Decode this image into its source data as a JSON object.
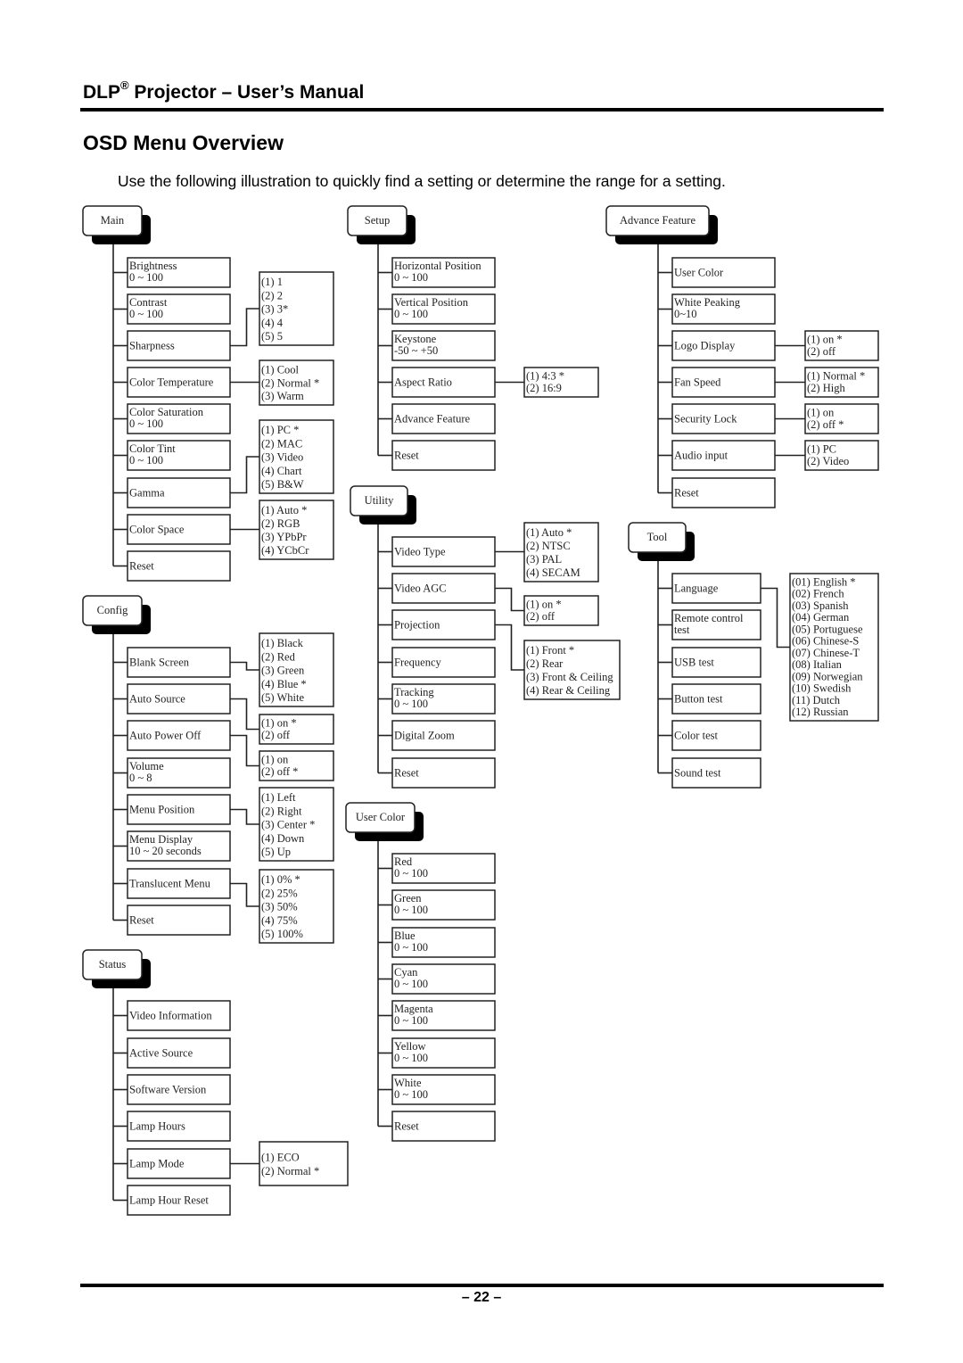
{
  "header": {
    "product": "DLP",
    "registered_mark": "®",
    "rest": " Projector – User’s Manual"
  },
  "section_title": "OSD Menu Overview",
  "intro": "Use the following illustration to quickly find a setting or determine the range for a setting.",
  "page_number": "– 22 –",
  "menus": [
    {
      "id": "main",
      "title": "Main",
      "items": [
        {
          "lines": [
            "Brightness",
            "0 ~ 100"
          ]
        },
        {
          "lines": [
            "Contrast",
            "0 ~ 100"
          ]
        },
        {
          "lines": [
            "Sharpness"
          ],
          "options": [
            "(1) 1",
            "(2) 2",
            "(3) 3*",
            "(4) 4",
            "(5) 5"
          ]
        },
        {
          "lines": [
            "Color Temperature"
          ],
          "options": [
            "(1) Cool",
            "(2) Normal *",
            "(3) Warm"
          ]
        },
        {
          "lines": [
            "Color Saturation",
            "0 ~ 100"
          ]
        },
        {
          "lines": [
            "Color Tint",
            "0 ~ 100"
          ]
        },
        {
          "lines": [
            "Gamma"
          ],
          "options": [
            "(1) PC *",
            "(2) MAC",
            "(3) Video",
            "(4) Chart",
            "(5) B&W"
          ]
        },
        {
          "lines": [
            "Color Space"
          ],
          "options": [
            "(1) Auto *",
            "(2) RGB",
            "(3) YPbPr",
            "(4) YCbCr"
          ]
        },
        {
          "lines": [
            "Reset"
          ]
        }
      ]
    },
    {
      "id": "config",
      "title": "Config",
      "items": [
        {
          "lines": [
            "Blank Screen"
          ],
          "options": [
            "(1) Black",
            "(2) Red",
            "(3) Green",
            "(4) Blue *",
            "(5) White"
          ]
        },
        {
          "lines": [
            "Auto Source"
          ],
          "options": [
            "(1) on *",
            "(2) off"
          ]
        },
        {
          "lines": [
            "Auto Power Off"
          ],
          "options": [
            "(1) on",
            "(2) off *"
          ]
        },
        {
          "lines": [
            "Volume",
            "0 ~ 8"
          ]
        },
        {
          "lines": [
            "Menu Position"
          ],
          "options": [
            "(1) Left",
            "(2) Right",
            "(3) Center *",
            "(4) Down",
            "(5) Up"
          ]
        },
        {
          "lines": [
            "Menu Display",
            "10 ~ 20 seconds"
          ]
        },
        {
          "lines": [
            "Translucent Menu"
          ],
          "options": [
            "(1) 0% *",
            "(2) 25%",
            "(3) 50%",
            "(4) 75%",
            "(5) 100%"
          ]
        },
        {
          "lines": [
            "Reset"
          ]
        }
      ]
    },
    {
      "id": "status",
      "title": "Status",
      "items": [
        {
          "lines": [
            "Video Information"
          ]
        },
        {
          "lines": [
            "Active Source"
          ]
        },
        {
          "lines": [
            "Software Version"
          ]
        },
        {
          "lines": [
            "Lamp Hours"
          ]
        },
        {
          "lines": [
            "Lamp Mode"
          ],
          "options": [
            "(1) ECO",
            "(2) Normal *"
          ]
        },
        {
          "lines": [
            "Lamp Hour Reset"
          ]
        }
      ]
    },
    {
      "id": "setup",
      "title": "Setup",
      "items": [
        {
          "lines": [
            "Horizontal Position",
            "0 ~ 100"
          ]
        },
        {
          "lines": [
            "Vertical Position",
            " 0 ~ 100"
          ]
        },
        {
          "lines": [
            "Keystone",
            "-50 ~ +50"
          ]
        },
        {
          "lines": [
            "Aspect Ratio"
          ],
          "options": [
            "(1) 4:3 *",
            "(2) 16:9"
          ]
        },
        {
          "lines": [
            "Advance Feature"
          ]
        },
        {
          "lines": [
            "Reset"
          ]
        }
      ]
    },
    {
      "id": "utility",
      "title": "Utility",
      "items": [
        {
          "lines": [
            "Video Type"
          ],
          "options": [
            "(1) Auto *",
            "(2) NTSC",
            "(3) PAL",
            "(4) SECAM"
          ]
        },
        {
          "lines": [
            "Video AGC"
          ],
          "options": [
            "(1) on *",
            "(2) off"
          ]
        },
        {
          "lines": [
            "Projection"
          ],
          "options": [
            "(1) Front *",
            "(2) Rear",
            "(3) Front & Ceiling",
            "(4) Rear & Ceiling"
          ]
        },
        {
          "lines": [
            "Frequency"
          ]
        },
        {
          "lines": [
            "Tracking",
            "0 ~ 100"
          ]
        },
        {
          "lines": [
            "Digital Zoom"
          ]
        },
        {
          "lines": [
            "Reset"
          ]
        }
      ]
    },
    {
      "id": "user-color",
      "title": "User Color",
      "items": [
        {
          "lines": [
            "Red",
            "0 ~ 100"
          ]
        },
        {
          "lines": [
            "Green",
            "0 ~ 100"
          ]
        },
        {
          "lines": [
            "Blue",
            "0 ~ 100"
          ]
        },
        {
          "lines": [
            "Cyan",
            "0 ~ 100"
          ]
        },
        {
          "lines": [
            "Magenta",
            "0 ~ 100"
          ]
        },
        {
          "lines": [
            "Yellow",
            "0 ~ 100"
          ]
        },
        {
          "lines": [
            "White",
            "0 ~ 100"
          ]
        },
        {
          "lines": [
            "Reset"
          ]
        }
      ]
    },
    {
      "id": "advance-feature",
      "title": "Advance Feature",
      "items": [
        {
          "lines": [
            "User Color"
          ]
        },
        {
          "lines": [
            "White Peaking",
            "0~10"
          ]
        },
        {
          "lines": [
            "Logo Display"
          ],
          "options": [
            "(1) on *",
            "(2) off"
          ]
        },
        {
          "lines": [
            "Fan Speed"
          ],
          "options": [
            "(1) Normal *",
            "(2) High"
          ]
        },
        {
          "lines": [
            "Security Lock"
          ],
          "options": [
            "(1) on",
            "(2) off *"
          ]
        },
        {
          "lines": [
            "Audio input"
          ],
          "options": [
            "(1) PC",
            "(2) Video"
          ]
        },
        {
          "lines": [
            "Reset"
          ]
        }
      ]
    },
    {
      "id": "tool",
      "title": "Tool",
      "items": [
        {
          "lines": [
            "Language"
          ],
          "options": [
            "(01) English *",
            "(02) French",
            "(03) Spanish",
            "(04) German",
            "(05) Portuguese",
            "(06) Chinese-S",
            "(07) Chinese-T",
            "(08) Italian",
            "(09) Norwegian",
            "(10) Swedish",
            "(11) Dutch",
            "(12) Russian"
          ]
        },
        {
          "lines": [
            "Remote control",
            "test"
          ]
        },
        {
          "lines": [
            "USB test"
          ]
        },
        {
          "lines": [
            "Button  test"
          ]
        },
        {
          "lines": [
            "Color  test"
          ]
        },
        {
          "lines": [
            "Sound  test"
          ]
        }
      ]
    }
  ]
}
